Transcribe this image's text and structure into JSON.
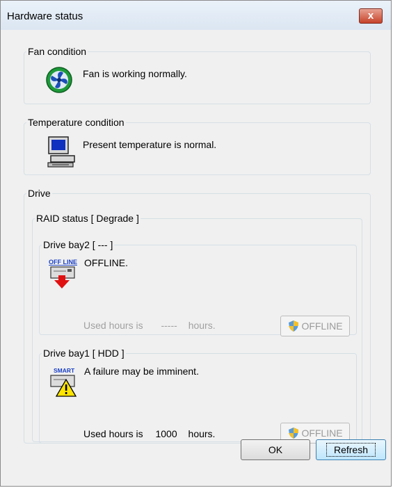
{
  "window": {
    "title": "Hardware status",
    "close_label": "x"
  },
  "fan": {
    "legend": "Fan condition",
    "icon": "fan-icon",
    "message": "Fan is working normally."
  },
  "temperature": {
    "legend": "Temperature condition",
    "icon": "computer-icon",
    "message": "Present temperature is normal."
  },
  "drive": {
    "legend": "Drive",
    "raid": {
      "legend": "RAID status [ Degrade ]",
      "bays": [
        {
          "legend": "Drive bay2 [ --- ]",
          "icon_badge": "OFF LINE",
          "icon": "offline-drive-icon",
          "message": "OFFLINE.",
          "used_prefix": "Used hours is",
          "used_value": "-----",
          "used_suffix": "hours.",
          "button_label": "OFFLINE",
          "state": "disabled"
        },
        {
          "legend": "Drive bay1 [ HDD ]",
          "icon_badge": "SMART",
          "icon": "smart-warning-icon",
          "message": "A failure may be imminent.",
          "used_prefix": "Used hours is",
          "used_value": "1000",
          "used_suffix": "hours.",
          "button_label": "OFFLINE",
          "state": "enabled"
        }
      ]
    }
  },
  "buttons": {
    "ok": "OK",
    "refresh": "Refresh"
  },
  "colors": {
    "titlebar": "#dbe6f2",
    "close": "#c7432a",
    "dialog_bg": "#f0f0f0",
    "disabled_text": "#a0a0a0"
  }
}
